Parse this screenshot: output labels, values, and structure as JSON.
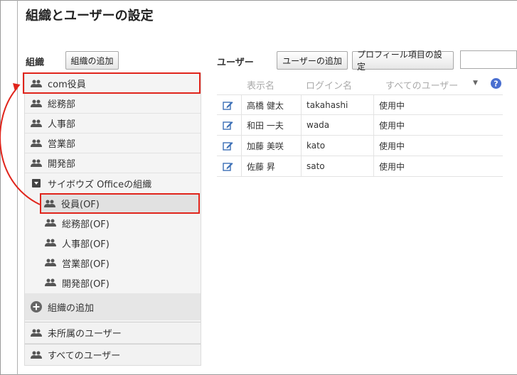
{
  "page": {
    "title": "組織とユーザーの設定"
  },
  "org_panel": {
    "label": "組織",
    "add_button": "組織の追加"
  },
  "user_panel": {
    "label": "ユーザー",
    "add_user_button": "ユーザーの追加",
    "profile_button": "プロフィール項目の設定",
    "search_value": ""
  },
  "sidebar": {
    "top_items": [
      {
        "label": "com役員"
      },
      {
        "label": "総務部"
      },
      {
        "label": "人事部"
      },
      {
        "label": "営業部"
      },
      {
        "label": "開発部"
      }
    ],
    "group": {
      "label": "サイボウズ Officeの組織",
      "items": [
        {
          "label": "役員(OF)"
        },
        {
          "label": "総務部(OF)"
        },
        {
          "label": "人事部(OF)"
        },
        {
          "label": "営業部(OF)"
        },
        {
          "label": "開発部(OF)"
        }
      ]
    },
    "add_org": "組織の追加",
    "unassigned": "未所属のユーザー",
    "all_users": "すべてのユーザー"
  },
  "table": {
    "headers": {
      "display_name": "表示名",
      "login_name": "ログイン名",
      "filter": "すべてのユーザー"
    },
    "rows": [
      {
        "name": "高橋 健太",
        "login": "takahashi",
        "status": "使用中"
      },
      {
        "name": "和田 一夫",
        "login": "wada",
        "status": "使用中"
      },
      {
        "name": "加藤 美咲",
        "login": "kato",
        "status": "使用中"
      },
      {
        "name": "佐藤 昇",
        "login": "sato",
        "status": "使用中"
      }
    ]
  },
  "colors": {
    "highlight": "#e0241b",
    "help": "#4a6fd0"
  }
}
